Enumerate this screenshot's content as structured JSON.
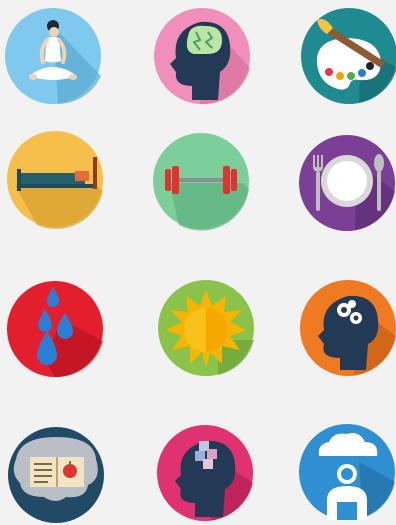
{
  "icons": [
    {
      "name": "meditation-icon",
      "color": "#7fc8ee"
    },
    {
      "name": "brain-mind-icon",
      "color": "#ef8fba"
    },
    {
      "name": "paint-palette-icon",
      "color": "#1f8a8f"
    },
    {
      "name": "bed-sleep-icon",
      "color": "#f6bf4a"
    },
    {
      "name": "dumbbell-exercise-icon",
      "color": "#7ccf9a"
    },
    {
      "name": "plate-cutlery-icon",
      "color": "#7b3f95"
    },
    {
      "name": "water-drops-icon",
      "color": "#e41f2d"
    },
    {
      "name": "sun-icon",
      "color": "#8bc34a"
    },
    {
      "name": "head-gears-icon",
      "color": "#ef7a22"
    },
    {
      "name": "brain-book-icon",
      "color": "#214a67"
    },
    {
      "name": "head-puzzle-icon",
      "color": "#e0326f"
    },
    {
      "name": "person-cloud-icon",
      "color": "#2f8fd0"
    }
  ]
}
